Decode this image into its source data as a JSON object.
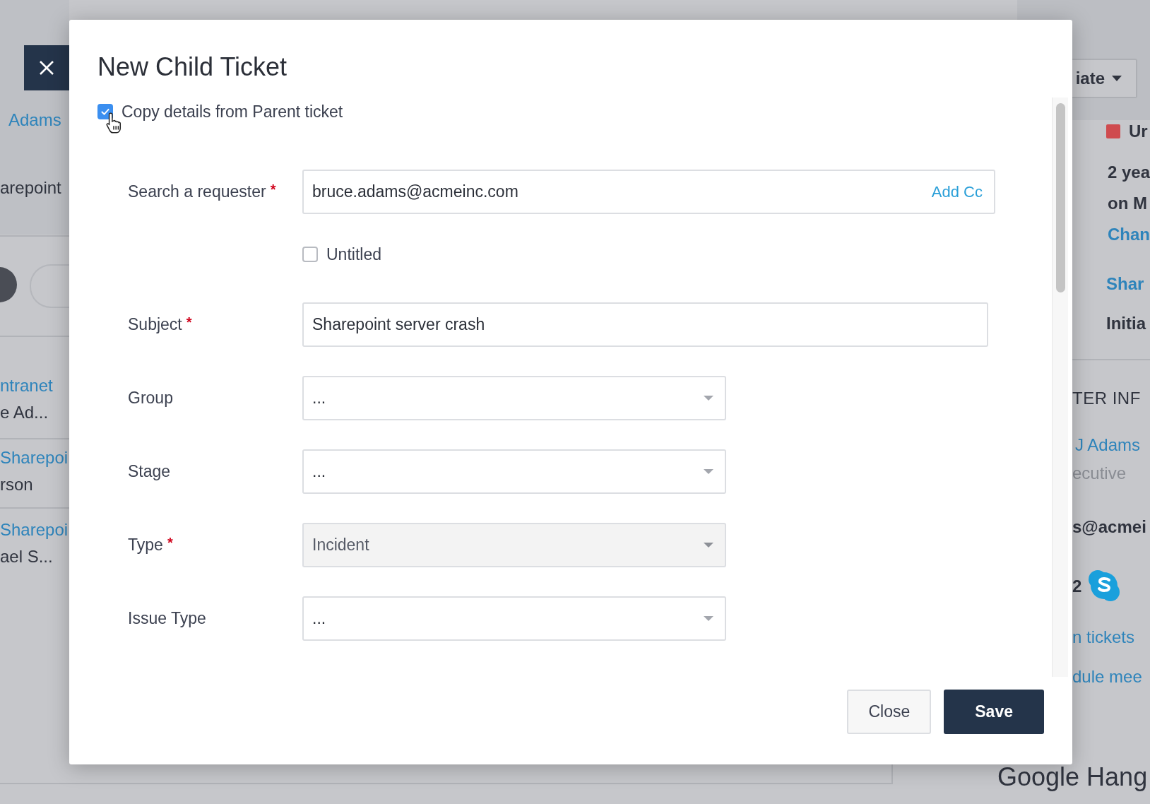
{
  "backdrop": {
    "close_button": {
      "kind": "close"
    },
    "left": [
      {
        "kind": "link",
        "text": "Adams"
      },
      {
        "kind": "text",
        "text": "arepoint"
      },
      {
        "kind": "link",
        "text": "ntranet"
      },
      {
        "kind": "text",
        "text": "e Ad..."
      },
      {
        "kind": "link",
        "text": "Sharepoi"
      },
      {
        "kind": "text",
        "text": "rson"
      },
      {
        "kind": "link",
        "text": "Sharepoi"
      },
      {
        "kind": "text",
        "text": "ael S..."
      }
    ],
    "right": [
      {
        "kind": "button",
        "text": "iate"
      },
      {
        "kind": "priority",
        "text": "Ur",
        "color": "#cf4b4f"
      },
      {
        "kind": "bold",
        "text": "2 yea"
      },
      {
        "kind": "bold",
        "text": "on M"
      },
      {
        "kind": "link",
        "text": "Chan"
      },
      {
        "kind": "link",
        "text": "Shar"
      },
      {
        "kind": "bold",
        "text": "Initia"
      },
      {
        "kind": "heading",
        "text": "TER INF"
      },
      {
        "kind": "link",
        "text": "J Adams"
      },
      {
        "kind": "muted",
        "text": "ecutive"
      },
      {
        "kind": "bold",
        "text": "s@acmei"
      },
      {
        "kind": "skype",
        "text": "2"
      },
      {
        "kind": "link",
        "text": "n tickets"
      },
      {
        "kind": "link",
        "text": "dule mee"
      },
      {
        "kind": "large",
        "text": "Google Hang"
      }
    ]
  },
  "modal": {
    "title": "New Child Ticket",
    "copy_details": {
      "label": "Copy details from Parent ticket",
      "checked": true
    },
    "fields": [
      {
        "kind": "text",
        "label": "Search a requester",
        "required_mark": "*",
        "value": "bruce.adams@acmeinc.com",
        "action": "Add Cc"
      },
      {
        "kind": "checkbox",
        "label": "Untitled",
        "checked": false
      },
      {
        "kind": "text",
        "label": "Subject",
        "required_mark": "*",
        "value": "Sharepoint server crash"
      },
      {
        "kind": "select",
        "label": "Group",
        "value": "...",
        "disabled": false
      },
      {
        "kind": "select",
        "label": "Stage",
        "value": "...",
        "disabled": false
      },
      {
        "kind": "select",
        "label": "Type",
        "required_mark": "*",
        "value": "Incident",
        "disabled": true
      },
      {
        "kind": "select",
        "label": "Issue Type",
        "value": "...",
        "disabled": false
      }
    ],
    "buttons": [
      {
        "kind": "secondary",
        "label": "Close"
      },
      {
        "kind": "primary",
        "label": "Save"
      }
    ]
  }
}
